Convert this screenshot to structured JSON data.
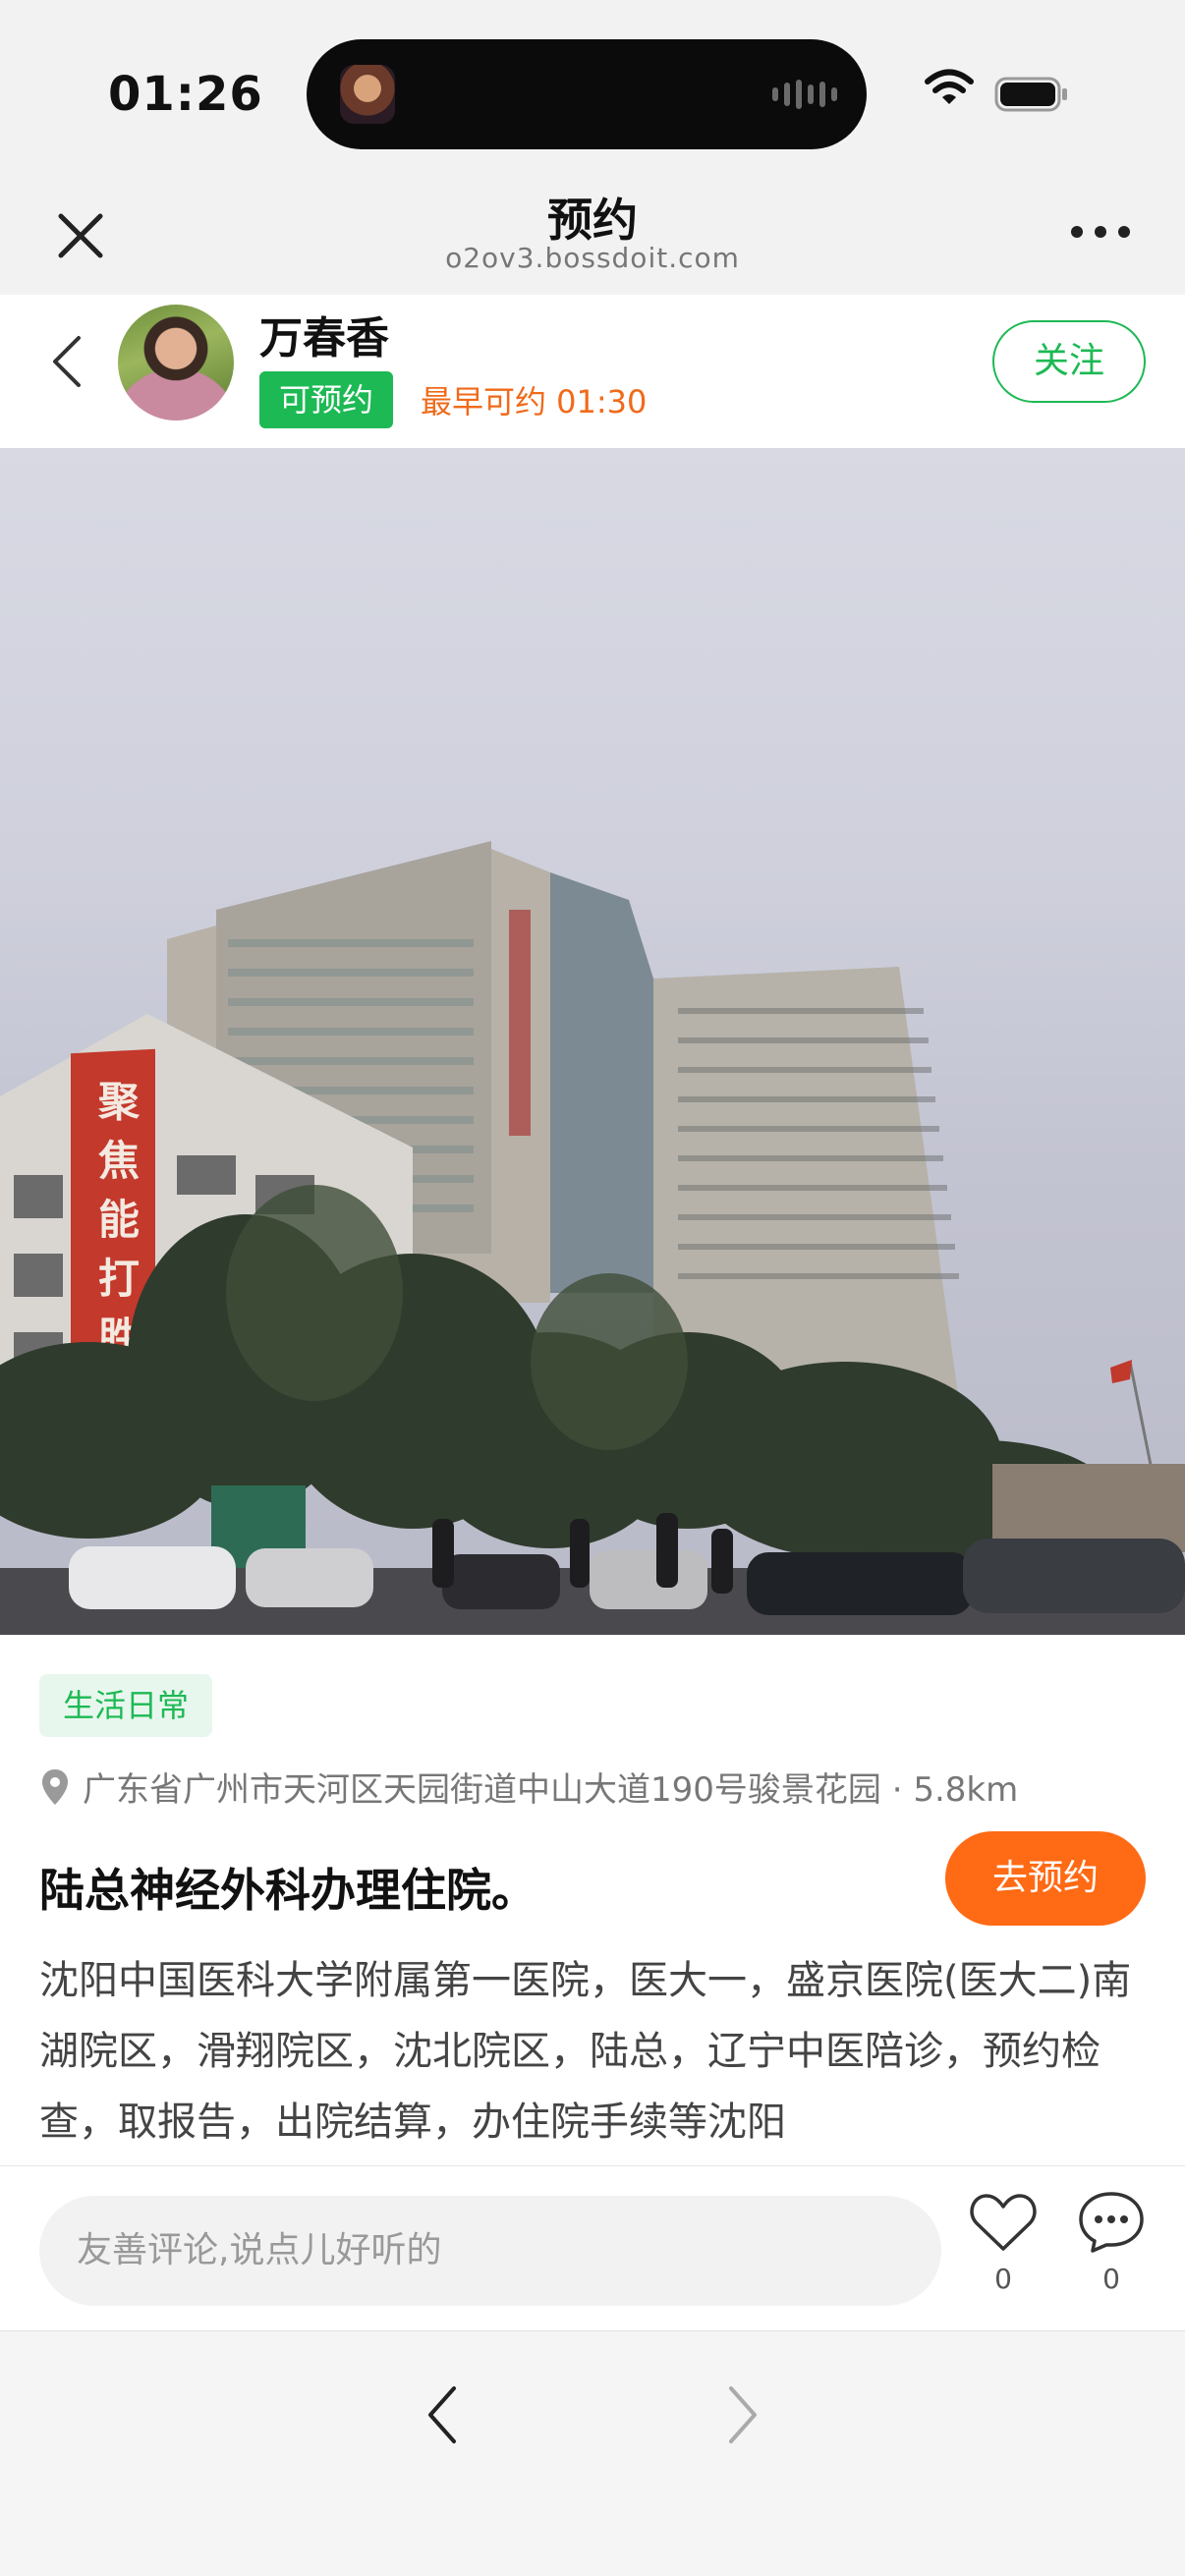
{
  "status_bar": {
    "time": "01:26"
  },
  "titlebar": {
    "title": "预约",
    "domain": "o2ov3.bossdoit.com"
  },
  "profile": {
    "name": "万春香",
    "status_badge": "可预约",
    "earliest": "最早可约 01:30",
    "follow_label": "关注"
  },
  "photo": {
    "sign_text": "聚焦能打胜"
  },
  "content": {
    "tag": "生活日常",
    "address": "广东省广州市天河区天园街道中山大道190号骏景花园 · 5.8km",
    "title": "陆总神经外科办理住院。",
    "book_label": "去预约",
    "description": "沈阳中国医科大学附属第一医院，医大一，盛京医院(医大二)南湖院区，滑翔院区，沈北院区，陆总，辽宁中医陪诊，预约检查，取报告，出院结算，办住院手续等沈阳"
  },
  "comment_bar": {
    "placeholder": "友善评论,说点儿好听的",
    "likes": "0",
    "comments": "0"
  },
  "colors": {
    "accent_green": "#1db954",
    "accent_orange": "#ff6a14"
  },
  "icons": [
    "close-icon",
    "more-icon",
    "back-chevron-icon",
    "location-pin-icon",
    "heart-icon",
    "comment-bubble-icon",
    "wifi-icon",
    "battery-icon"
  ]
}
